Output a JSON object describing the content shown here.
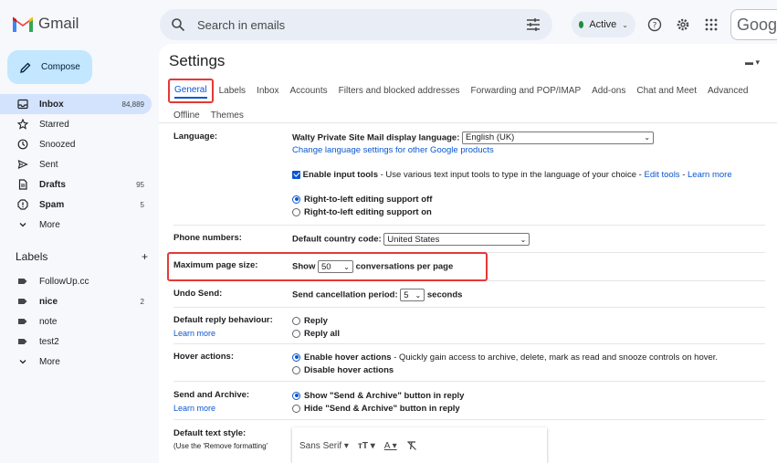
{
  "app": {
    "name": "Gmail"
  },
  "header": {
    "search_placeholder": "Search in emails",
    "status": "Active",
    "google_text": "Googl"
  },
  "sidebar": {
    "compose_label": "Compose",
    "items": [
      {
        "label": "Inbox",
        "count": "84,889",
        "icon": "inbox-icon"
      },
      {
        "label": "Starred",
        "count": "",
        "icon": "star-icon"
      },
      {
        "label": "Snoozed",
        "count": "",
        "icon": "clock-icon"
      },
      {
        "label": "Sent",
        "count": "",
        "icon": "send-icon"
      },
      {
        "label": "Drafts",
        "count": "95",
        "icon": "draft-icon"
      },
      {
        "label": "Spam",
        "count": "5",
        "icon": "spam-icon"
      },
      {
        "label": "More",
        "count": "",
        "icon": "chevron-down-icon"
      }
    ],
    "labels_title": "Labels",
    "labels": [
      {
        "label": "FollowUp.cc",
        "count": ""
      },
      {
        "label": "nice",
        "count": "2"
      },
      {
        "label": "note",
        "count": ""
      },
      {
        "label": "test2",
        "count": ""
      },
      {
        "label": "More",
        "count": ""
      }
    ]
  },
  "settings": {
    "title": "Settings",
    "kbd_toggle": "▬ ▾",
    "tabs": [
      "General",
      "Labels",
      "Inbox",
      "Accounts",
      "Filters and blocked addresses",
      "Forwarding and POP/IMAP",
      "Add-ons",
      "Chat and Meet",
      "Advanced",
      "Offline",
      "Themes"
    ],
    "language": {
      "label": "Language:",
      "display_prefix": "Walty Private Site Mail display language:",
      "display_value": "English (UK)",
      "change_link": "Change language settings for other Google products",
      "input_tools_label": "Enable input tools",
      "input_tools_desc": " - Use various text input tools to type in the language of your choice - ",
      "edit_tools": "Edit tools",
      "sep": " - ",
      "learn_more": "Learn more",
      "rtl_off": "Right-to-left editing support off",
      "rtl_on": "Right-to-left editing support on"
    },
    "phone": {
      "label": "Phone numbers:",
      "prefix": "Default country code:",
      "value": "United States"
    },
    "page_size": {
      "label": "Maximum page size:",
      "show": "Show",
      "value": "50",
      "suffix": "conversations per page"
    },
    "undo_send": {
      "label": "Undo Send:",
      "prefix": "Send cancellation period:",
      "value": "5",
      "suffix": "seconds"
    },
    "reply": {
      "label": "Default reply behaviour:",
      "learn_more": "Learn more",
      "opt1": "Reply",
      "opt2": "Reply all"
    },
    "hover": {
      "label": "Hover actions:",
      "opt1": "Enable hover actions",
      "opt1_desc": " - Quickly gain access to archive, delete, mark as read and snooze controls on hover.",
      "opt2": "Disable hover actions"
    },
    "send_archive": {
      "label": "Send and Archive:",
      "learn_more": "Learn more",
      "opt1": "Show \"Send & Archive\" button in reply",
      "opt2": "Hide \"Send & Archive\" button in reply"
    },
    "text_style": {
      "label": "Default text style:",
      "note": "(Use the 'Remove formatting'",
      "font": "Sans Serif"
    }
  }
}
